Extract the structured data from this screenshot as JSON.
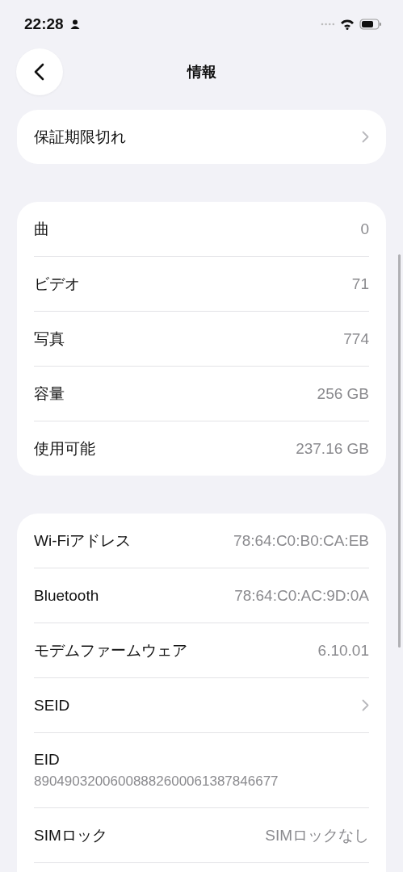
{
  "status_bar": {
    "time": "22:28"
  },
  "nav": {
    "title": "情報"
  },
  "sections": [
    {
      "rows": [
        {
          "kind": "chevron",
          "label": "保証期限切れ"
        }
      ]
    },
    {
      "rows": [
        {
          "kind": "value",
          "label": "曲",
          "value": "0"
        },
        {
          "kind": "value",
          "label": "ビデオ",
          "value": "71"
        },
        {
          "kind": "value",
          "label": "写真",
          "value": "774"
        },
        {
          "kind": "value",
          "label": "容量",
          "value": "256 GB"
        },
        {
          "kind": "value",
          "label": "使用可能",
          "value": "237.16 GB"
        }
      ]
    },
    {
      "rows": [
        {
          "kind": "value",
          "label": "Wi-Fiアドレス",
          "value": "78:64:C0:B0:CA:EB"
        },
        {
          "kind": "value",
          "label": "Bluetooth",
          "value": "78:64:C0:AC:9D:0A"
        },
        {
          "kind": "value",
          "label": "モデムファームウェア",
          "value": "6.10.01"
        },
        {
          "kind": "chevron",
          "label": "SEID"
        },
        {
          "kind": "stacked",
          "label": "EID",
          "value": "89049032006008882600061387846677"
        },
        {
          "kind": "value",
          "label": "SIMロック",
          "value": "SIMロックなし"
        }
      ],
      "continues": true
    }
  ]
}
